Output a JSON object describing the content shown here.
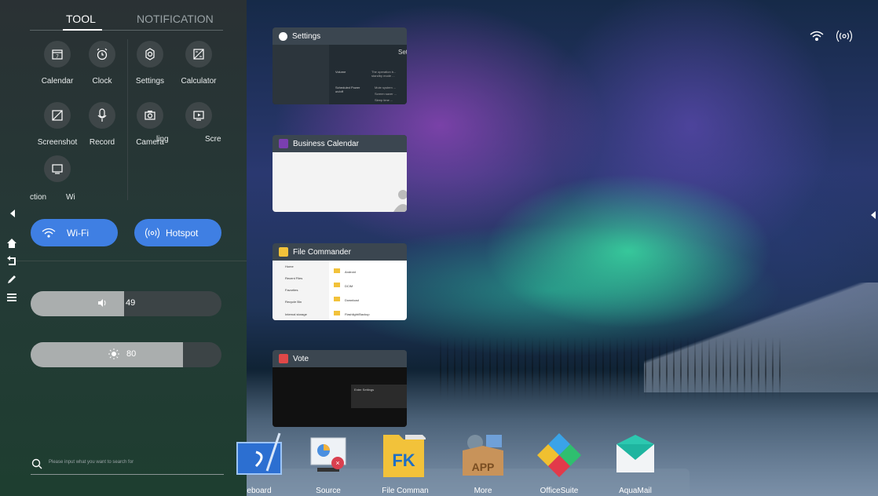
{
  "tabs": {
    "tool": "TOOL",
    "notification": "NOTIFICATION"
  },
  "tools": [
    {
      "label": "Calendar",
      "icon": "calendar-icon"
    },
    {
      "label": "Clock",
      "icon": "clock-icon"
    },
    {
      "label": "Settings",
      "icon": "settings-icon"
    },
    {
      "label": "Calculator",
      "icon": "calculator-icon"
    },
    {
      "label": "Screenshot",
      "icon": "screenshot-icon"
    },
    {
      "label": "Record",
      "icon": "microphone-icon"
    },
    {
      "label": "Camera",
      "icon": "camera-icon"
    },
    {
      "label": "ling",
      "icon": ""
    },
    {
      "label": "Scre",
      "icon": "screen-record-icon"
    },
    {
      "label": "ction",
      "icon": "projection-icon"
    },
    {
      "label": "Wi",
      "icon": ""
    }
  ],
  "toggles": {
    "wifi": "Wi-Fi",
    "hotspot": "Hotspot"
  },
  "volume": {
    "value": "49",
    "level": 0.49
  },
  "brightness": {
    "value": "80",
    "level": 0.8
  },
  "search": {
    "placeholder": "Please input what you want to search for"
  },
  "recents": {
    "settings": {
      "title": "Settings",
      "header_fragment": "Set",
      "rows": [
        "Volume",
        "Scheduled Power on/off"
      ],
      "desc": [
        "The operation b... standby mode ...",
        "Mute system ...",
        "Screen saver ...",
        "Sleep time ..."
      ]
    },
    "calendar": {
      "title": "Business Calendar"
    },
    "files": {
      "title": "File Commander",
      "sidebar": [
        "Home",
        "Recent Files",
        "Favorites",
        "Recycle Bin",
        "Internal storage"
      ],
      "folders": [
        "Android",
        "DCIM",
        "Download",
        "Flashlight/Backup"
      ]
    },
    "vote": {
      "title": "Vote",
      "button": "Enter Settings"
    }
  },
  "dock": [
    {
      "label": "eboard",
      "icon": "whiteboard-icon"
    },
    {
      "label": "Source",
      "icon": "source-icon"
    },
    {
      "label": "File Comman",
      "icon": "file-commander-icon"
    },
    {
      "label": "More",
      "icon": "app-box-icon"
    },
    {
      "label": "OfficeSuite",
      "icon": "officesuite-icon"
    },
    {
      "label": "AquaMail",
      "icon": "aquamail-icon"
    }
  ],
  "colors": {
    "accent": "#3f7fe3",
    "panel": "#2a3134"
  }
}
